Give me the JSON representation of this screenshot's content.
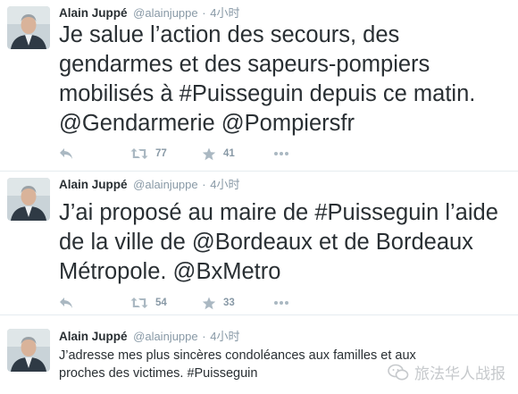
{
  "tweets": [
    {
      "author_name": "Alain Juppé",
      "handle": "@alainjuppe",
      "separator": "·",
      "time": "4小时",
      "text_lines": [
        "Je salue l’action des secours, des",
        "gendarmes et des sapeurs-pompiers",
        "mobilisés à #Puisseguin depuis ce matin.",
        "@Gendarmerie @Pompiersfr"
      ],
      "retweets": "77",
      "favorites": "41"
    },
    {
      "author_name": "Alain Juppé",
      "handle": "@alainjuppe",
      "separator": "·",
      "time": "4小时",
      "text_lines": [
        "J’ai proposé au maire de #Puisseguin l’aide",
        "de la ville de @Bordeaux et de Bordeaux",
        "Métropole. @BxMetro"
      ],
      "retweets": "54",
      "favorites": "33"
    },
    {
      "author_name": "Alain Juppé",
      "handle": "@alainjuppe",
      "separator": "·",
      "time": "4小时",
      "text_lines": [
        "J’adresse mes plus sincères condoléances aux familles et aux",
        "proches des victimes. #Puisseguin"
      ]
    }
  ],
  "watermark": {
    "text": "旅法华人战报",
    "icon": "wechat-logo-icon"
  },
  "icons": {
    "reply": "reply-icon",
    "retweet": "retweet-icon",
    "favorite": "star-icon",
    "more": "more-icon"
  },
  "colors": {
    "text": "#292f33",
    "muted": "#8899a6",
    "icon": "#aab8c2",
    "divider": "#e6ecf0"
  }
}
